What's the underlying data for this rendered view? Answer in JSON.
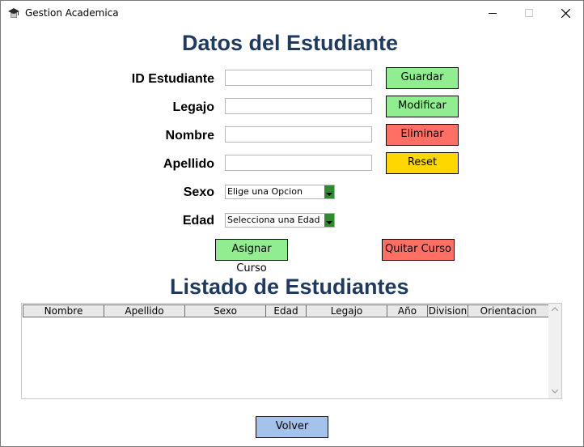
{
  "window": {
    "title": "Gestion Academica"
  },
  "form": {
    "heading": "Datos del Estudiante",
    "labels": {
      "id": "ID Estudiante",
      "legajo": "Legajo",
      "nombre": "Nombre",
      "apellido": "Apellido",
      "sexo": "Sexo",
      "edad": "Edad"
    },
    "values": {
      "id": "",
      "legajo": "",
      "nombre": "",
      "apellido": ""
    },
    "sexo_select": "Elige una Opcion",
    "edad_select": "Selecciona una Edad"
  },
  "buttons": {
    "guardar": "Guardar",
    "modificar": "Modificar",
    "eliminar": "Eliminar",
    "reset": "Reset",
    "asignar": "Asignar Curso",
    "quitar": "Quitar Curso",
    "volver": "Volver"
  },
  "list": {
    "heading": "Listado de Estudiantes",
    "columns": [
      "Nombre",
      "Apellido",
      "Sexo",
      "Edad",
      "Legajo",
      "Año",
      "Division",
      "Orientacion"
    ],
    "rows": []
  },
  "colors": {
    "heading": "#1f3a5f",
    "green": "#90ee90",
    "red": "#ff6f64",
    "yellow": "#ffd700",
    "blue": "#a3c3ec"
  }
}
